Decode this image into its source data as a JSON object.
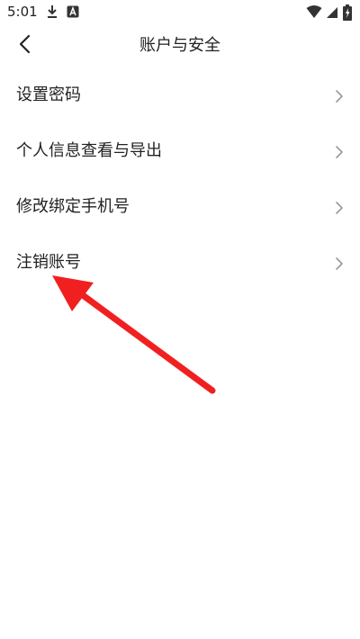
{
  "status_bar": {
    "time": "5:01",
    "icons": [
      "download-icon",
      "a-notification-icon",
      "wifi-icon",
      "cellular-signal-icon",
      "battery-charging-icon"
    ]
  },
  "header": {
    "back_icon": "chevron-left-icon",
    "title": "账户与安全"
  },
  "menu": {
    "items": [
      {
        "label": "设置密码",
        "icon": "chevron-right-icon"
      },
      {
        "label": "个人信息查看与导出",
        "icon": "chevron-right-icon"
      },
      {
        "label": "修改绑定手机号",
        "icon": "chevron-right-icon"
      },
      {
        "label": "注销账号",
        "icon": "chevron-right-icon"
      }
    ]
  },
  "annotation": {
    "arrow_color": "#f02020",
    "target": "注销账号"
  },
  "colors": {
    "text": "#222222",
    "chevron": "#9a9a9a",
    "background": "#ffffff"
  }
}
